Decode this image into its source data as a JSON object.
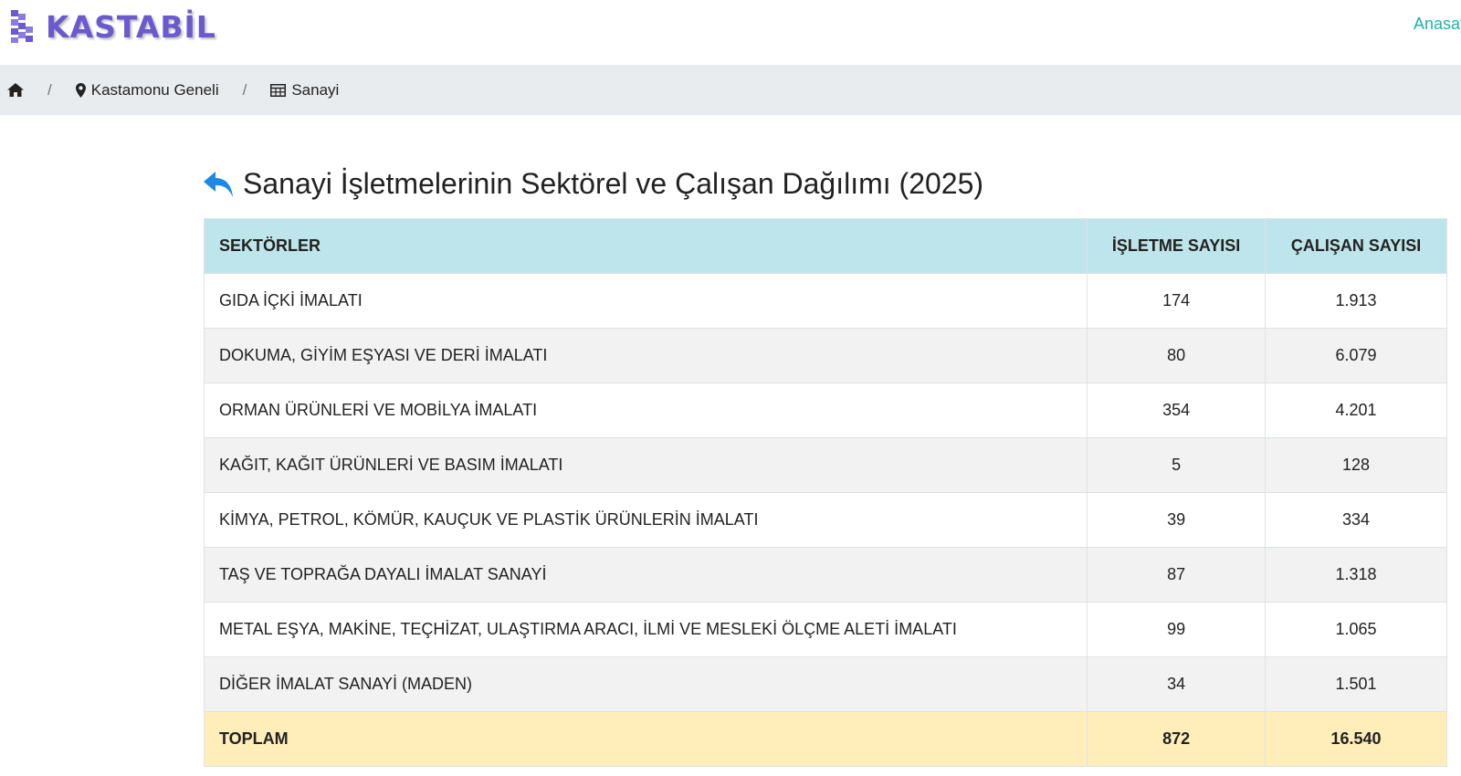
{
  "header": {
    "brand": "KASTABİL",
    "nav_home": "Anasayfa",
    "colors": {
      "brand": "#6a5acd",
      "nav_link": "#20b2aa",
      "accent_blue": "#1e88e5"
    }
  },
  "breadcrumb": {
    "home_icon": "home-icon",
    "items": [
      {
        "icon": "map-marker-icon",
        "label": "Kastamonu Geneli"
      },
      {
        "icon": "table-icon",
        "label": "Sanayi"
      }
    ],
    "separator": "/"
  },
  "page": {
    "title": "Sanayi İşletmelerinin Sektörel ve Çalışan Dağılımı (2025)",
    "back_icon": "reply-arrow-icon"
  },
  "table": {
    "headers": [
      "SEKTÖRLER",
      "İŞLETME SAYISI",
      "ÇALIŞAN SAYISI"
    ],
    "rows": [
      {
        "sector": "GIDA İÇKİ İMALATI",
        "firms": "174",
        "employees": "1.913"
      },
      {
        "sector": "DOKUMA, GİYİM EŞYASI VE DERİ İMALATI",
        "firms": "80",
        "employees": "6.079"
      },
      {
        "sector": "ORMAN ÜRÜNLERİ VE MOBİLYA İMALATI",
        "firms": "354",
        "employees": "4.201"
      },
      {
        "sector": "KAĞIT, KAĞIT ÜRÜNLERİ VE BASIM İMALATI",
        "firms": "5",
        "employees": "128"
      },
      {
        "sector": "KİMYA, PETROL, KÖMÜR, KAUÇUK VE PLASTİK ÜRÜNLERİN İMALATI",
        "firms": "39",
        "employees": "334"
      },
      {
        "sector": "TAŞ VE TOPRAĞA DAYALI İMALAT SANAYİ",
        "firms": "87",
        "employees": "1.318"
      },
      {
        "sector": "METAL EŞYA, MAKİNE, TEÇHİZAT, ULAŞTIRMA ARACI, İLMİ VE MESLEKİ ÖLÇME ALETİ İMALATI",
        "firms": "99",
        "employees": "1.065"
      },
      {
        "sector": "DİĞER İMALAT SANAYİ (MADEN)",
        "firms": "34",
        "employees": "1.501"
      }
    ],
    "total": {
      "label": "TOPLAM",
      "firms": "872",
      "employees": "16.540"
    }
  }
}
